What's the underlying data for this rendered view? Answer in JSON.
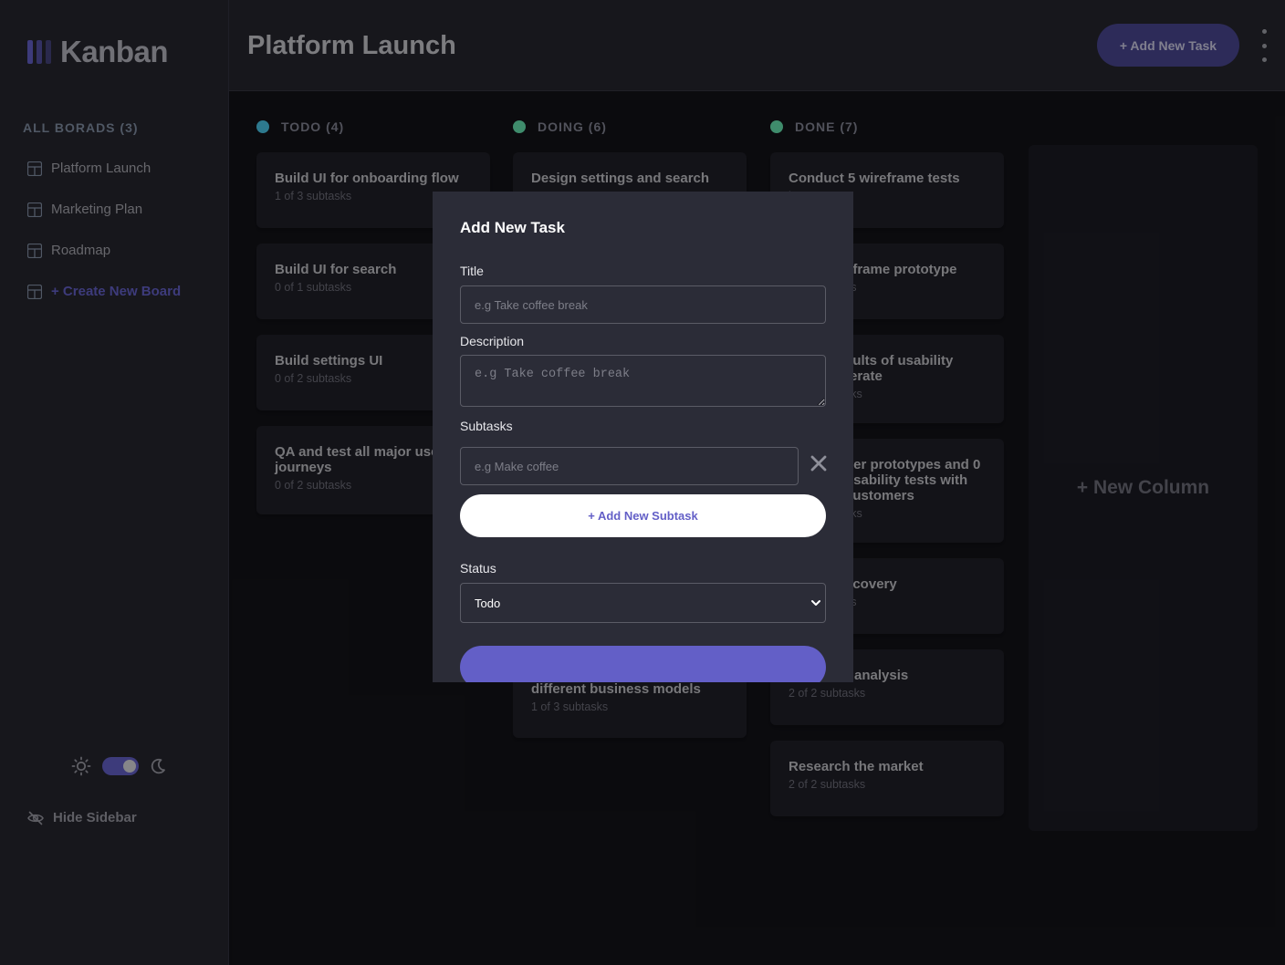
{
  "sidebar": {
    "logo_text": "Kanban",
    "boards_heading": "ALL BORADS (3)",
    "boards": [
      {
        "label": "Platform Launch"
      },
      {
        "label": "Marketing Plan"
      },
      {
        "label": "Roadmap"
      }
    ],
    "create_board_label": "+ Create New Board",
    "hide_sidebar_label": "Hide Sidebar",
    "theme": "dark"
  },
  "header": {
    "title": "Platform Launch",
    "add_task_label": "+ Add New Task"
  },
  "columns": [
    {
      "name": "TODO (4)",
      "color": "#49c4e5",
      "cards": [
        {
          "title": "Build UI for onboarding flow",
          "subtasks": "1 of 3 subtasks"
        },
        {
          "title": "Build UI for search",
          "subtasks": "0 of 1 subtasks"
        },
        {
          "title": "Build settings UI",
          "subtasks": "0 of 2 subtasks"
        },
        {
          "title": "QA and test all major user journeys",
          "subtasks": "0 of 2 subtasks"
        }
      ]
    },
    {
      "name": "DOING (6)",
      "color": "#67e2ae",
      "cards": [
        {
          "title": "Design settings and search",
          "subtasks": ""
        },
        {
          "title": "different business models",
          "subtasks": "1 of 3 subtasks"
        }
      ]
    },
    {
      "name": "DONE (7)",
      "color": "#67e2ae",
      "cards": [
        {
          "title": "Conduct 5 wireframe tests",
          "subtasks": "ks"
        },
        {
          "title": "eframe prototype",
          "subtasks": "ks"
        },
        {
          "title": "sults of usability terate",
          "subtasks": "sks"
        },
        {
          "title": "per prototypes and 0 usability tests with customers",
          "subtasks": "sks"
        },
        {
          "title": "scovery",
          "subtasks": "ks"
        },
        {
          "title": "r analysis",
          "subtasks": "2 of 2 subtasks"
        },
        {
          "title": "Research the market",
          "subtasks": "2 of 2 subtasks"
        }
      ]
    }
  ],
  "new_column_label": "+ New Column",
  "modal": {
    "title": "Add New Task",
    "title_label": "Title",
    "title_placeholder": "e.g Take coffee break",
    "description_label": "Description",
    "description_placeholder": "e.g Take coffee break",
    "subtasks_label": "Subtasks",
    "subtask_placeholder": "e.g Make coffee",
    "add_subtask_label": "+ Add New Subtask",
    "status_label": "Status",
    "status_value": "Todo"
  },
  "colors": {
    "accent": "#635fc7",
    "todo_dot": "#49c4e5",
    "doing_dot": "#67e2ae",
    "done_dot": "#67e2ae"
  }
}
